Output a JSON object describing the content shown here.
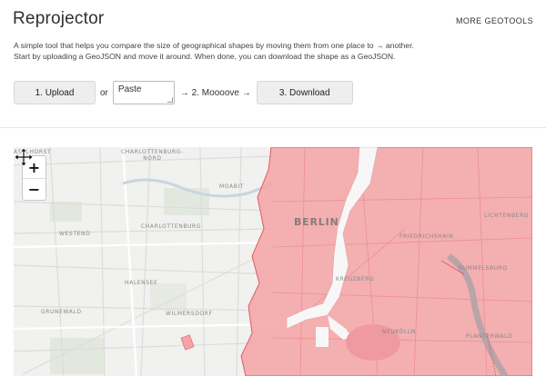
{
  "header": {
    "title": "Reprojector",
    "more_link": "MORE GEOTOOLS"
  },
  "intro": {
    "line1": "A simple tool that helps you compare the size of geographical shapes by moving them from one place to → another.",
    "line2": "Start by uploading a GeoJSON and move it around. When done, you can download the shape as a GeoJSON."
  },
  "toolbar": {
    "upload_label": "1. Upload",
    "or_label": "or",
    "paste_placeholder": "Paste",
    "move_step": "→ 2. Moooove →",
    "download_label": "3. Download"
  },
  "map": {
    "zoom_in": "+",
    "zoom_out": "−",
    "overlay_color": "#f4a3a6",
    "labels": {
      "aselhorst": "ASELHORST",
      "charlottenburg_nord": "CHARLOTTENBURG-\nNORD",
      "moabit": "MOABIT",
      "charlottenburg": "CHARLOTTENBURG",
      "westend": "WESTEND",
      "berlin": "BERLIN",
      "lichtenberg": "LICHTENBERG",
      "friedrichshain": "FRIEDRICHSHAIN",
      "rummelsburg": "RUMMELSBURG",
      "halensee": "HALENSEE",
      "kreuzberg": "KREUZBERG",
      "grunewald": "GRUNEWALD",
      "wilmersdorf": "WILMERSDORF",
      "neukolln": "NEUKÖLLN",
      "plaenterwald": "PLANTERWALD"
    }
  }
}
